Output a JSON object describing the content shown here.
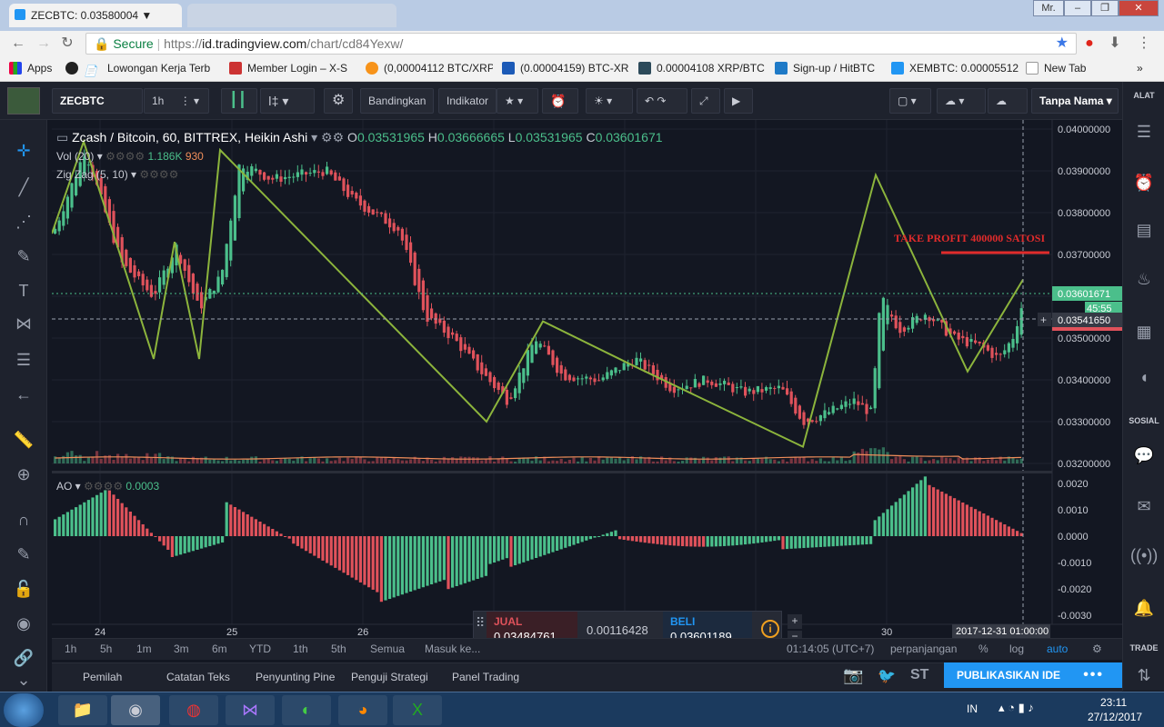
{
  "browser": {
    "active_tab": "ZECBTC: 0.03580004 ▼",
    "inactive_tab": "",
    "url_secure": "Secure",
    "url_prefix": "https://",
    "url_host": "id.tradingview.com",
    "url_path": "/chart/cd84Yexw/",
    "window_user": "Mr.",
    "bookmarks": [
      "Apps",
      "Lowongan Kerja Terb",
      "Member Login – X-S",
      "(0,00004112 BTC/XRP",
      "(0.00004159) BTC-XR",
      "0.00004108 XRP/BTC",
      "Sign-up / HitBTC",
      "XEMBTC: 0.00005512",
      "New Tab"
    ]
  },
  "toolbar": {
    "symbol": "ZECBTC",
    "interval": "1h",
    "compare": "Bandingkan",
    "indicators": "Indikator",
    "layout_name": "Tanpa Nama"
  },
  "right_panel": {
    "alat": "ALAT",
    "sosial": "SOSIAL",
    "trade": "TRADE"
  },
  "legend": {
    "title": "Zcash / Bitcoin, 60, BITTREX, Heikin Ashi",
    "o_label": "O",
    "o_val": "0.03531965",
    "h_label": "H",
    "h_val": "0.03666665",
    "l_label": "L",
    "l_val": "0.03531965",
    "c_label": "C",
    "c_val": "0.03601671",
    "vol": "Vol (20)",
    "vol_val1": "1.186K",
    "vol_val2": "930",
    "zigzag": "Zig Zag (5, 10)",
    "ao": "AO",
    "ao_val": "0.0003"
  },
  "annotation": "TAKE PROFIT 400000 SATOSI",
  "price_axis": {
    "ticks": [
      "0.04000000",
      "0.03900000",
      "0.03800000",
      "0.03700000",
      "0.03600000",
      "0.03500000",
      "0.03400000",
      "0.03300000",
      "0.03200000"
    ],
    "last_price": "0.03601671",
    "countdown": "45:55",
    "crosshair_price": "0.03541650"
  },
  "ao_axis": {
    "ticks": [
      "0.0020",
      "0.0010",
      "0.0000",
      "-0.0010",
      "-0.0020",
      "-0.0030"
    ]
  },
  "time_axis": {
    "labels": [
      "24",
      "25",
      "26",
      "30"
    ],
    "crosshair_time": "2017-12-31 01:00:00"
  },
  "trade_panel": {
    "sell_label": "JUAL",
    "sell_price": "0.03484761",
    "spread": "0.00116428",
    "buy_label": "BELI",
    "buy_price": "0.03601189"
  },
  "bottom_bar": {
    "ranges": [
      "1h",
      "5h",
      "1m",
      "3m",
      "6m",
      "YTD",
      "1th",
      "5th",
      "Semua",
      "Masuk ke..."
    ],
    "clock": "01:14:05 (UTC+7)",
    "extended": "perpanjangan",
    "percent": "%",
    "log": "log",
    "auto": "auto"
  },
  "bottom_tabs": [
    "Pemilah",
    "Catatan Teks",
    "Penyunting Pine",
    "Penguji Strategi",
    "Panel Trading"
  ],
  "publish": "PUBLIKASIKAN IDE",
  "taskbar": {
    "lang": "IN",
    "time": "23:11",
    "date": "27/12/2017"
  },
  "colors": {
    "up": "#4bbf8b",
    "down": "#e0525b",
    "zigzag": "#8cb43c",
    "accent": "#2196f3",
    "annotation": "#e02b2b"
  }
}
